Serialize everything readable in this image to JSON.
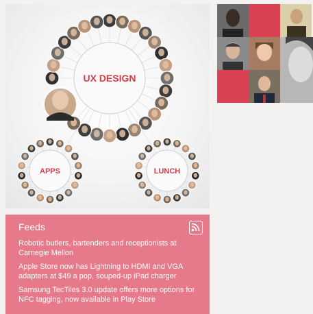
{
  "graph": {
    "hubs": [
      {
        "label": "UX DESIGN"
      },
      {
        "label": "APPS"
      },
      {
        "label": "LUNCH"
      }
    ]
  },
  "people_tile": {
    "colors": {
      "accent_red": "#d94253"
    }
  },
  "feeds": {
    "title": "Feeds",
    "icon": "rss-icon",
    "items": [
      {
        "text": "Robotic butlers, bartenders and receptionists at Carnegie Mellon"
      },
      {
        "text": "Apple Store now has Lightning to HDMI and VGA adapters at $49 a pop, souped-up iPad charger"
      },
      {
        "text": "Samsung TecTiles 3.0 update offers more options for NFC tagging, now available in Play Store"
      }
    ],
    "colors": {
      "background": "#e67a8b",
      "text": "#ffffff"
    }
  }
}
